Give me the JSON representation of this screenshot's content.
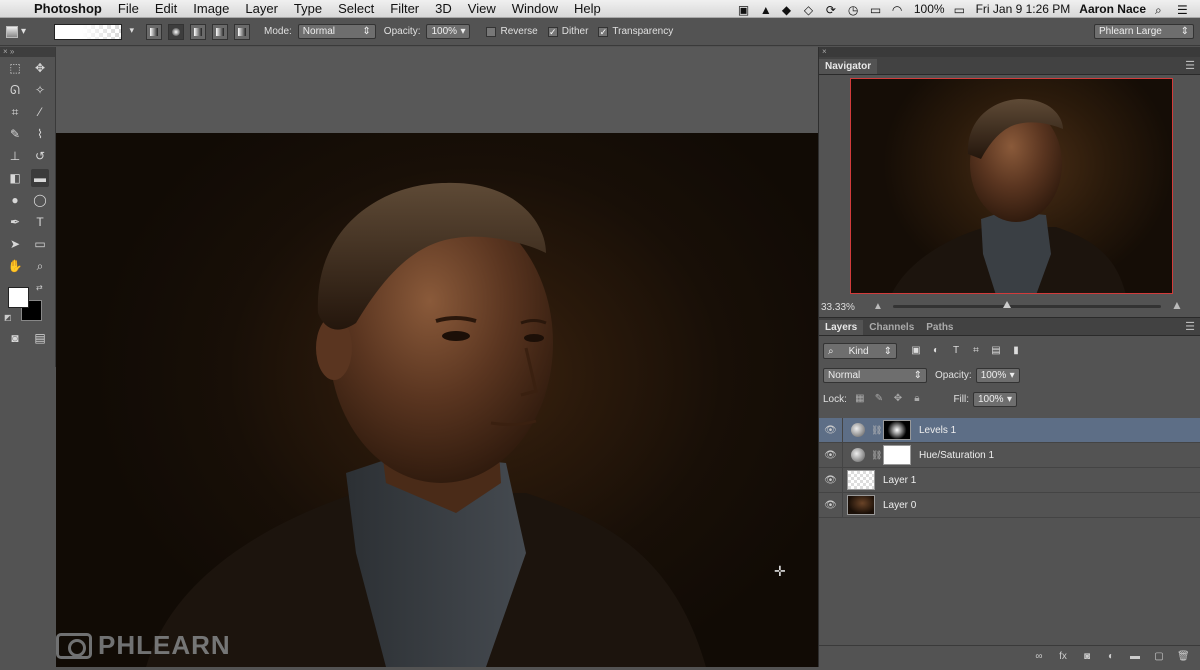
{
  "menubar": {
    "app": "Photoshop",
    "items": [
      "File",
      "Edit",
      "Image",
      "Layer",
      "Type",
      "Select",
      "Filter",
      "3D",
      "View",
      "Window",
      "Help"
    ],
    "battery": "100%",
    "datetime": "Fri Jan 9  1:26 PM",
    "user": "Aaron Nace"
  },
  "options": {
    "mode_label": "Mode:",
    "mode_value": "Normal",
    "opacity_label": "Opacity:",
    "opacity_value": "100%",
    "reverse": "Reverse",
    "dither": "Dither",
    "transparency": "Transparency",
    "workspace": "Phlearn Large"
  },
  "navigator": {
    "tab": "Navigator",
    "zoom": "33.33%"
  },
  "layers_panel": {
    "tabs": [
      "Layers",
      "Channels",
      "Paths"
    ],
    "kind": "Kind",
    "blend_mode": "Normal",
    "opacity_label": "Opacity:",
    "opacity_value": "100%",
    "lock_label": "Lock:",
    "fill_label": "Fill:",
    "fill_value": "100%",
    "layers": [
      {
        "name": "Levels 1",
        "selected": true
      },
      {
        "name": "Hue/Saturation 1",
        "selected": false
      },
      {
        "name": "Layer 1",
        "selected": false
      },
      {
        "name": "Layer 0",
        "selected": false
      }
    ]
  },
  "watermark": "PHLEARN"
}
